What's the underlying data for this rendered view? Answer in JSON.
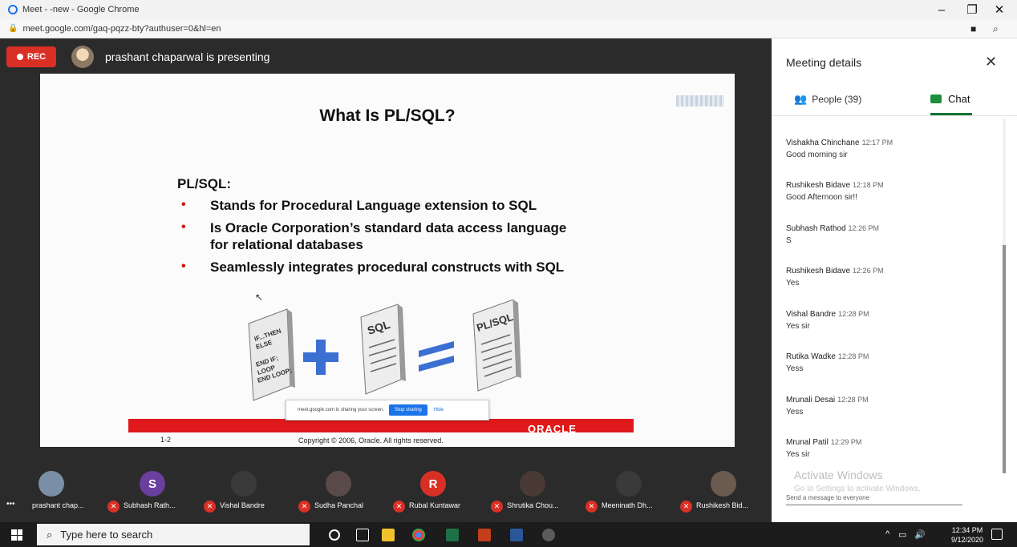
{
  "window": {
    "title": "Meet - -new - Google Chrome",
    "url": "meet.google.com/gaq-pqzz-bty?authuser=0&hl=en",
    "minimize": "–",
    "maximize": "❐",
    "close": "✕"
  },
  "meeting": {
    "rec_label": "REC",
    "presenting_text": "prashant chaparwal is presenting"
  },
  "slide": {
    "title": "What Is PL/SQL?",
    "heading": "PL/SQL:",
    "bullets": [
      "Stands for Procedural Language extension to SQL",
      "Is Oracle Corporation’s standard data access language for relational databases",
      "Seamlessly integrates procedural constructs with SQL"
    ],
    "diagram": {
      "doc1_lines": [
        "IF...THEN",
        "ELSE",
        "END IF;",
        "LOOP",
        "END LOOP;"
      ],
      "doc2_label": "SQL",
      "doc3_label": "PL/SQL"
    },
    "brand": "ORACLE",
    "page_number": "1-2",
    "copyright": "Copyright © 2006, Oracle.  All rights reserved."
  },
  "share_bar": {
    "text": "meet.google.com is sharing your screen.",
    "stop_label": "Stop sharing",
    "hide_label": "Hide"
  },
  "participants": [
    {
      "name": "prashant chap...",
      "initial": "",
      "color": "#7a8fa6"
    },
    {
      "name": "Subhash Rath...",
      "initial": "S",
      "color": "#6a3fa0"
    },
    {
      "name": "Vishal Bandre",
      "initial": "",
      "color": "#3a3a3a"
    },
    {
      "name": "Sudha Panchal",
      "initial": "",
      "color": "#5a4a4a"
    },
    {
      "name": "Rubal Kuntawar",
      "initial": "R",
      "color": "#d93025"
    },
    {
      "name": "Shrutika Chou...",
      "initial": "",
      "color": "#4a3a35"
    },
    {
      "name": "Meeninath Dh...",
      "initial": "",
      "color": "#3a3a3a"
    },
    {
      "name": "Rushikesh Bid...",
      "initial": "",
      "color": "#6a5a50"
    }
  ],
  "panel": {
    "title": "Meeting details",
    "close": "✕",
    "tab_people": "People (39)",
    "tab_chat": "Chat",
    "messages": [
      {
        "sender": "Vishakha Chinchane",
        "time": "12:17 PM",
        "text": "Good morning sir"
      },
      {
        "sender": "Rushikesh Bidave",
        "time": "12:18 PM",
        "text": "Good Afternoon sir!!"
      },
      {
        "sender": "Subhash Rathod",
        "time": "12:26 PM",
        "text": "S"
      },
      {
        "sender": "Rushikesh Bidave",
        "time": "12:26 PM",
        "text": "Yes"
      },
      {
        "sender": "Vishal Bandre",
        "time": "12:28 PM",
        "text": "Yes sir"
      },
      {
        "sender": "Rutika Wadke",
        "time": "12:28 PM",
        "text": "Yess"
      },
      {
        "sender": "Mrunali Desai",
        "time": "12:28 PM",
        "text": "Yess"
      },
      {
        "sender": "Mrunal Patil",
        "time": "12:29 PM",
        "text": "Yes sir"
      }
    ],
    "watermark_title": "Activate Windows",
    "watermark_sub": "Go to Settings to activate Windows.",
    "send_placeholder": "Send a message to everyone"
  },
  "taskbar": {
    "search_placeholder": "Type here to search",
    "time": "12:34 PM",
    "date": "9/12/2020"
  }
}
